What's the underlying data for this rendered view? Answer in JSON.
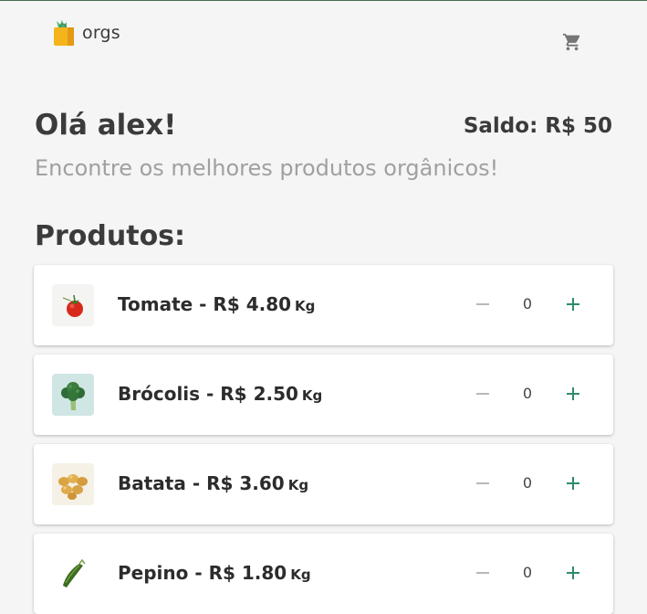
{
  "header": {
    "logo_text": "orgs",
    "logo_icon": "shopping-bag-icon",
    "cart_icon": "cart-icon"
  },
  "main": {
    "greeting": "Olá alex!",
    "balance": "Saldo: R$ 50",
    "subtitle": "Encontre os melhores produtos orgânicos!",
    "products_title": "Produtos:"
  },
  "products": [
    {
      "name": "Tomate - R$ 4.80",
      "unit": "Kg",
      "quantity": "0",
      "image_icon": "tomato-icon"
    },
    {
      "name": "Brócolis - R$ 2.50",
      "unit": "Kg",
      "quantity": "0",
      "image_icon": "broccoli-icon"
    },
    {
      "name": "Batata - R$ 3.60",
      "unit": "Kg",
      "quantity": "0",
      "image_icon": "potato-icon"
    },
    {
      "name": "Pepino - R$ 1.80",
      "unit": "Kg",
      "quantity": "0",
      "image_icon": "cucumber-icon"
    }
  ],
  "colors": {
    "accent": "#2e8b6e",
    "background": "#f5f5f5",
    "text": "#3b3b3b",
    "muted": "#a0a0a0"
  }
}
